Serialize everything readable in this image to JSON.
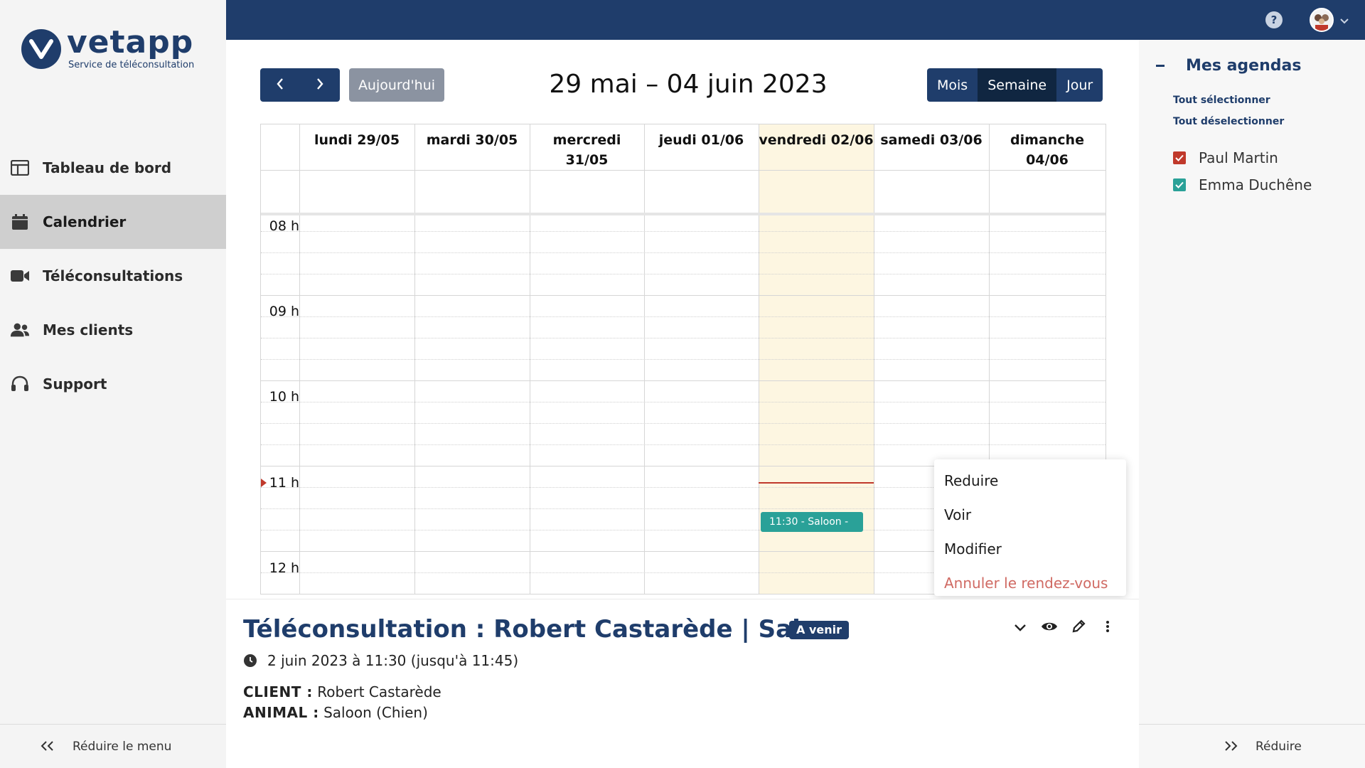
{
  "brand": {
    "name": "vetapp",
    "tagline": "Service de téléconsultation",
    "color": "#1f3d6b"
  },
  "sidebar": {
    "items": [
      {
        "label": "Tableau de bord",
        "icon": "dashboard-icon",
        "active": false
      },
      {
        "label": "Calendrier",
        "icon": "calendar-icon",
        "active": true
      },
      {
        "label": "Téléconsultations",
        "icon": "video-camera-icon",
        "active": false
      },
      {
        "label": "Mes clients",
        "icon": "users-icon",
        "active": false
      },
      {
        "label": "Support",
        "icon": "headset-icon",
        "active": false
      }
    ],
    "collapse_label": "Réduire le menu"
  },
  "topbar": {
    "help_symbol": "?"
  },
  "toolbar": {
    "today_label": "Aujourd'hui",
    "range_title": "29 mai – 04 juin 2023",
    "views": [
      "Mois",
      "Semaine",
      "Jour"
    ],
    "active_view": "Semaine"
  },
  "calendar": {
    "days": [
      "lundi 29/05",
      "mardi 30/05",
      "mercredi 31/05",
      "jeudi 01/06",
      "vendredi 02/06",
      "samedi 03/06",
      "dimanche 04/06"
    ],
    "today_index": 4,
    "hours": [
      "08 h",
      "09 h",
      "10 h",
      "11 h",
      "12 h"
    ],
    "event": {
      "label": "11:30 - Saloon -",
      "color": "#2aa198"
    },
    "now_color": "#c0392b",
    "today_bg": "#fdf6e1"
  },
  "context_menu": {
    "items": [
      "Reduire",
      "Voir",
      "Modifier",
      "Annuler le rendez-vous"
    ],
    "danger_color": "#d06a63"
  },
  "details": {
    "title": "Téléconsultation : Robert Castarède | Saloon",
    "status": "A venir",
    "datetime": "2 juin 2023 à 11:30 (jusqu'à 11:45)",
    "client_label": "CLIENT :",
    "client_value": "Robert Castarède",
    "animal_label": "ANIMAL :",
    "animal_value": "Saloon (Chien)"
  },
  "agendas": {
    "title": "Mes agendas",
    "select_all": "Tout sélectionner",
    "deselect_all": "Tout déselectionner",
    "items": [
      {
        "name": "Paul Martin",
        "checked": true,
        "color": "#c0392b"
      },
      {
        "name": "Emma Duchêne",
        "checked": true,
        "color": "#2aa198"
      }
    ],
    "collapse_label": "Réduire"
  }
}
